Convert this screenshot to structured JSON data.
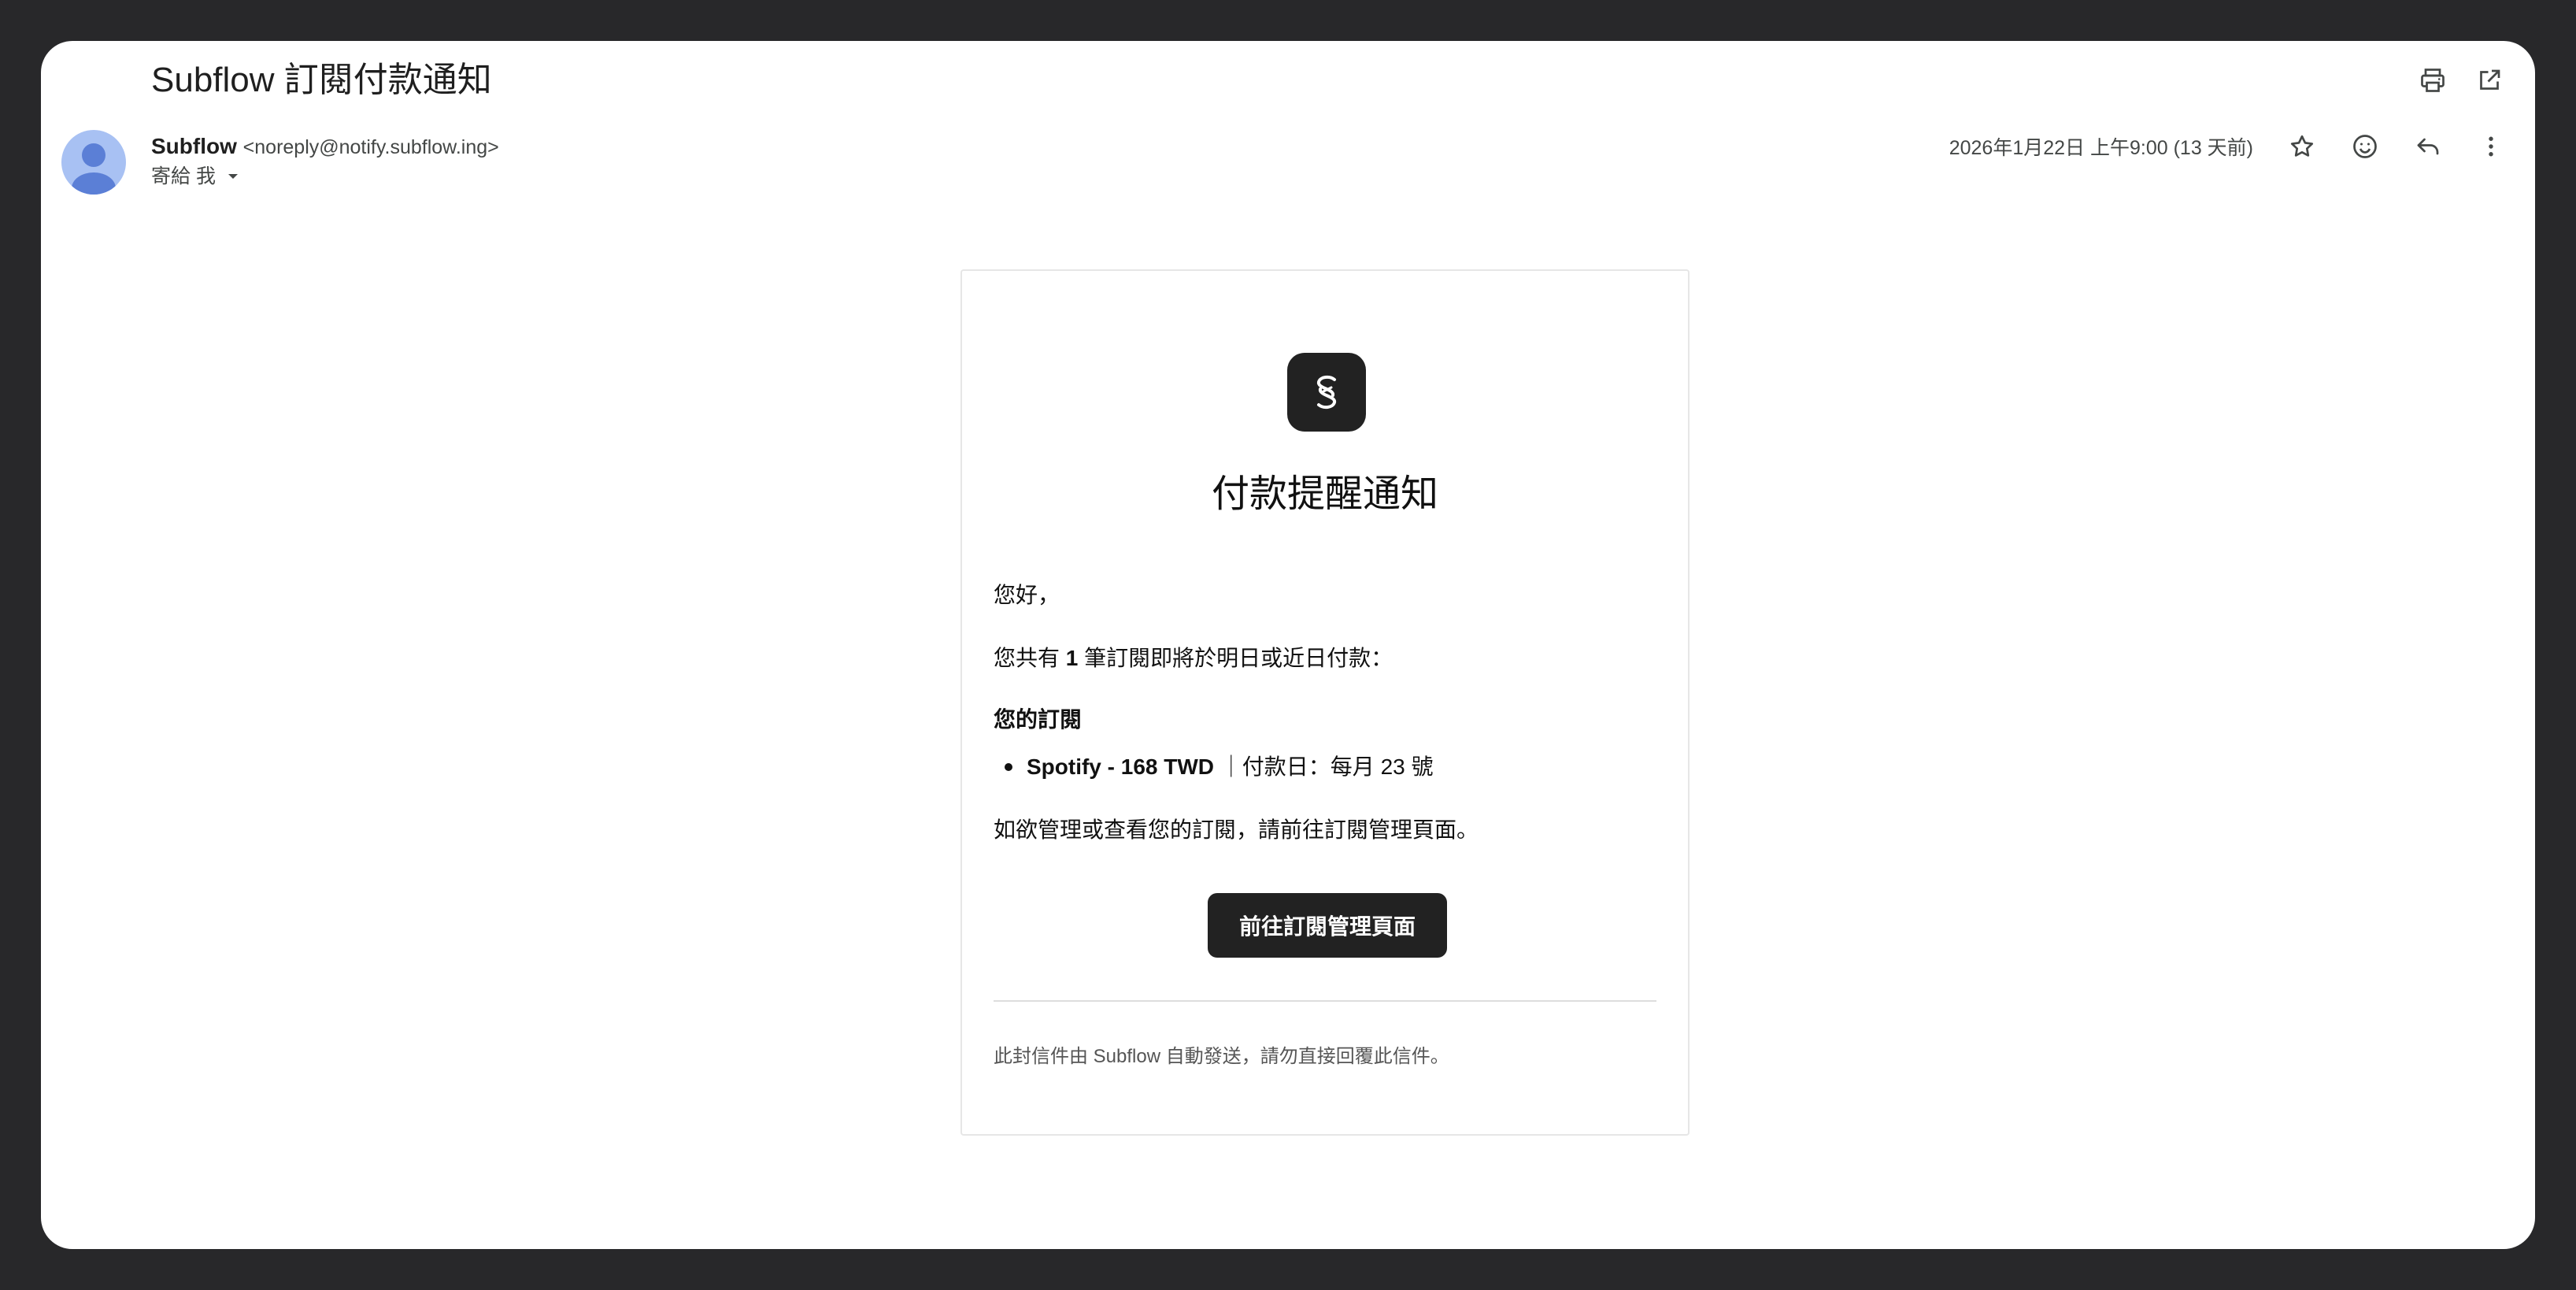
{
  "email": {
    "subject": "Subflow 訂閱付款通知",
    "sender_name": "Subflow",
    "sender_email": "<noreply@notify.subflow.ing>",
    "to_label": "寄給 我",
    "date": "2026年1月22日 上午9:00 (13 天前)"
  },
  "body": {
    "title": "付款提醒通知",
    "greeting": "您好，",
    "count_prefix": "您共有 ",
    "count_value": "1",
    "count_suffix": " 筆訂閱即將於明日或近日付款：",
    "section_heading": "您的訂閱",
    "subscriptions": [
      {
        "name_price": "Spotify - 168 TWD",
        "detail": " ｜付款日：每月 23 號"
      }
    ],
    "manage_text": "如欲管理或查看您的訂閱，請前往訂閱管理頁面。",
    "cta_label": "前往訂閱管理頁面",
    "footer_note": "此封信件由 Subflow 自動發送，請勿直接回覆此信件。"
  },
  "icons": {
    "print": "print-icon",
    "open_new_window": "open-in-new-icon",
    "star": "star-icon",
    "emoji": "emoji-icon",
    "reply": "reply-icon",
    "more": "more-vert-icon",
    "logo": "subflow-logo-icon"
  },
  "colors": {
    "frame_bg": "#28282a",
    "card_bg": "#ffffff",
    "button_bg": "#222222",
    "avatar_bg": "#a8c1f3",
    "avatar_fg": "#5b7fd6"
  }
}
